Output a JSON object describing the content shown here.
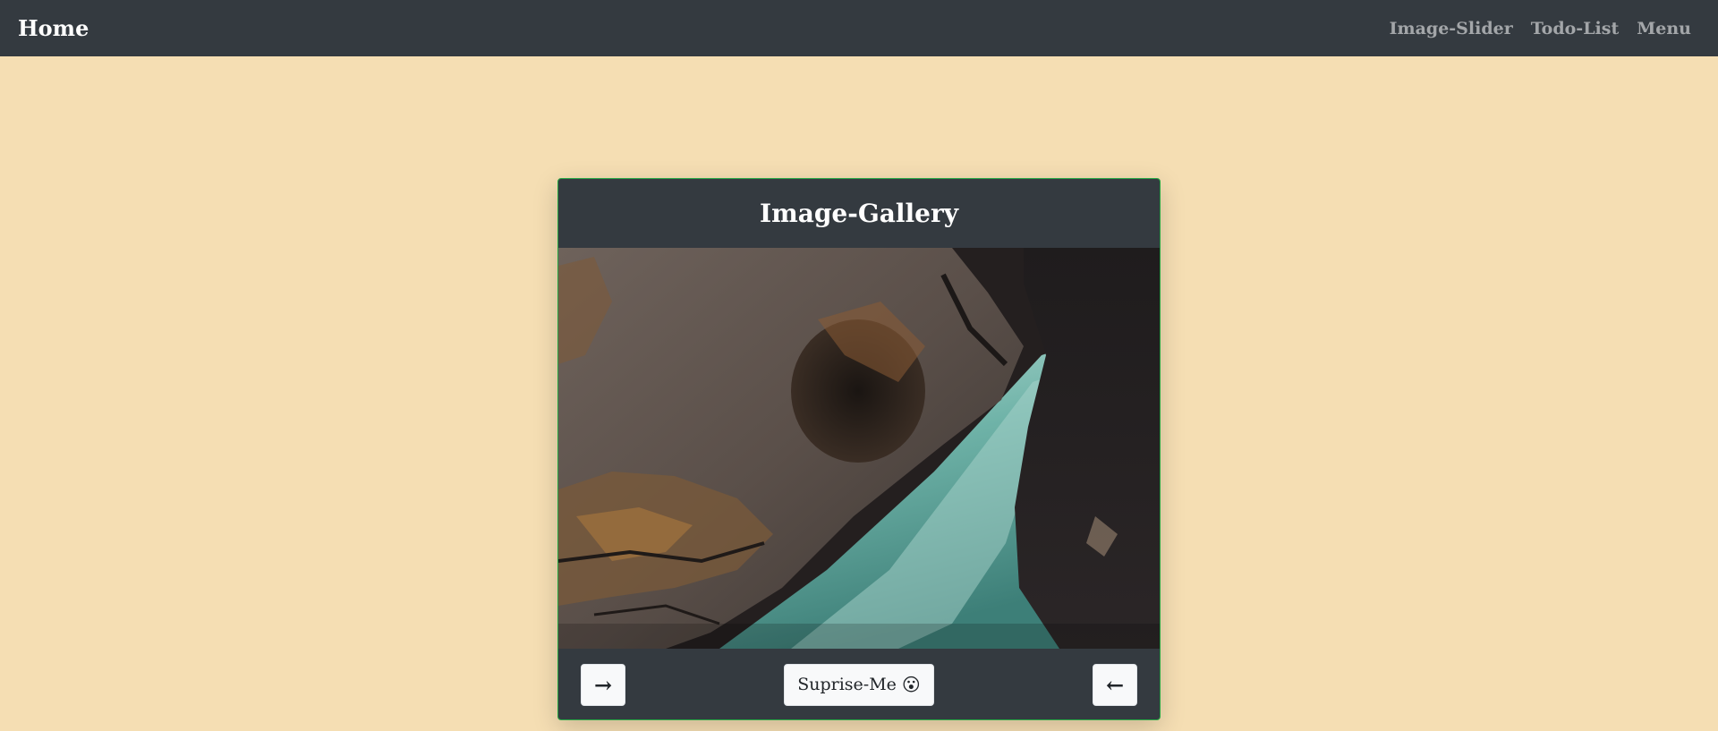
{
  "navbar": {
    "brand": "Home",
    "links": [
      {
        "label": "Image-Slider"
      },
      {
        "label": "Todo-List"
      },
      {
        "label": "Menu"
      }
    ]
  },
  "gallery": {
    "title": "Image-Gallery",
    "image_alt": "rocky gorge with turquoise river",
    "next_label": "→",
    "prev_label": "←",
    "surprise_label": "Suprise-Me",
    "surprise_emoji": "😮"
  },
  "colors": {
    "page_bg": "#f5deb3",
    "navbar_bg": "#343a40",
    "card_bg": "#343a40",
    "card_border": "#28a745",
    "button_bg": "#f8f9fa"
  }
}
